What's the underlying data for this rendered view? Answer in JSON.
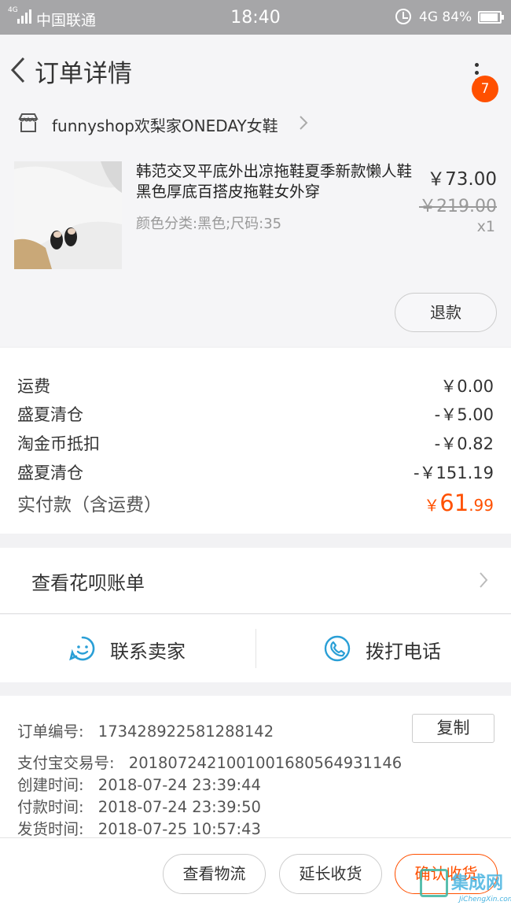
{
  "status_bar": {
    "network_small": "4G",
    "carrier": "中国联通",
    "time": "18:40",
    "network": "4G",
    "battery": "84%"
  },
  "nav": {
    "title": "订单详情",
    "badge_count": "7"
  },
  "shop": {
    "name": "funnyshop欢梨家ONEDAY女鞋"
  },
  "item": {
    "title": "韩范交叉平底外出凉拖鞋夏季新款懒人鞋黑色厚底百搭皮拖鞋女外穿",
    "sku": "颜色分类:黑色;尺码:35",
    "price": "￥73.00",
    "original_price": "￥219.00",
    "quantity": "x1",
    "refund_label": "退款"
  },
  "fees": {
    "rows": [
      {
        "label": "运费",
        "value": "￥0.00"
      },
      {
        "label": "盛夏清仓",
        "value": "-￥5.00"
      },
      {
        "label": "淘金币抵扣",
        "value": "-￥0.82"
      },
      {
        "label": "盛夏清仓",
        "value": "-￥151.19"
      }
    ],
    "total_label": "实付款（含运费）",
    "total_currency": "￥",
    "total_integer": "61",
    "total_decimal": ".99"
  },
  "huabei": {
    "label": "查看花呗账单"
  },
  "contact": {
    "seller_label": "联系卖家",
    "phone_label": "拨打电话"
  },
  "order_info": {
    "order_no_label": "订单编号:",
    "order_no": "173428922581288142",
    "copy_label": "复制",
    "alipay_label": "支付宝交易号:",
    "alipay_no": "2018072421001001680564931146",
    "created_label": "创建时间:",
    "created": "2018-07-24 23:39:44",
    "paid_label": "付款时间:",
    "paid": "2018-07-24 23:39:50",
    "shipped_label": "发货时间:",
    "shipped": "2018-07-25 10:57:43"
  },
  "actions": {
    "logistics": "查看物流",
    "extend": "延长收货",
    "confirm": "确认收货"
  },
  "watermark": {
    "text": "集成网",
    "url": "JiChengXin.com"
  },
  "colors": {
    "accent": "#ff5000",
    "icon_blue": "#2a9fd6",
    "status_bar": "#a6a6a8"
  }
}
